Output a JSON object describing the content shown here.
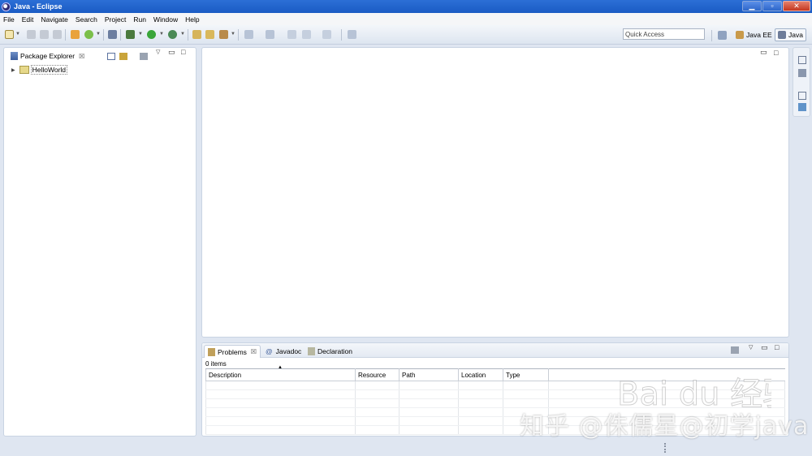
{
  "window": {
    "title": "Java - Eclipse",
    "controls": {
      "minimize": "▁",
      "maximize": "▫",
      "close": "✕"
    }
  },
  "menubar": {
    "items": [
      "File",
      "Edit",
      "Navigate",
      "Search",
      "Project",
      "Run",
      "Window",
      "Help"
    ]
  },
  "toolbar": {
    "quick_access_value": "Quick Access",
    "perspectives": [
      {
        "label": "Java EE",
        "active": false
      },
      {
        "label": "Java",
        "active": true
      }
    ]
  },
  "package_explorer": {
    "tab_label": "Package Explorer",
    "close_glyph": "☒",
    "tree": [
      {
        "label": "HelloWorld",
        "expanded": false
      }
    ]
  },
  "bottom_panel": {
    "tabs": [
      {
        "label": "Problems",
        "active": true,
        "close_glyph": "☒"
      },
      {
        "label": "Javadoc",
        "active": false,
        "prefix": "@"
      },
      {
        "label": "Declaration",
        "active": false
      }
    ],
    "items_count": "0 items",
    "columns": [
      "Description",
      "Resource",
      "Path",
      "Location",
      "Type"
    ]
  },
  "watermark": {
    "text": "知乎 @侏儒星@初学java",
    "logo_text": "Bai du 经验"
  },
  "colors": {
    "title_bar": "#1a5bc4",
    "background": "#dfe6f1",
    "panel": "#ffffff",
    "close_button": "#c4371f"
  }
}
